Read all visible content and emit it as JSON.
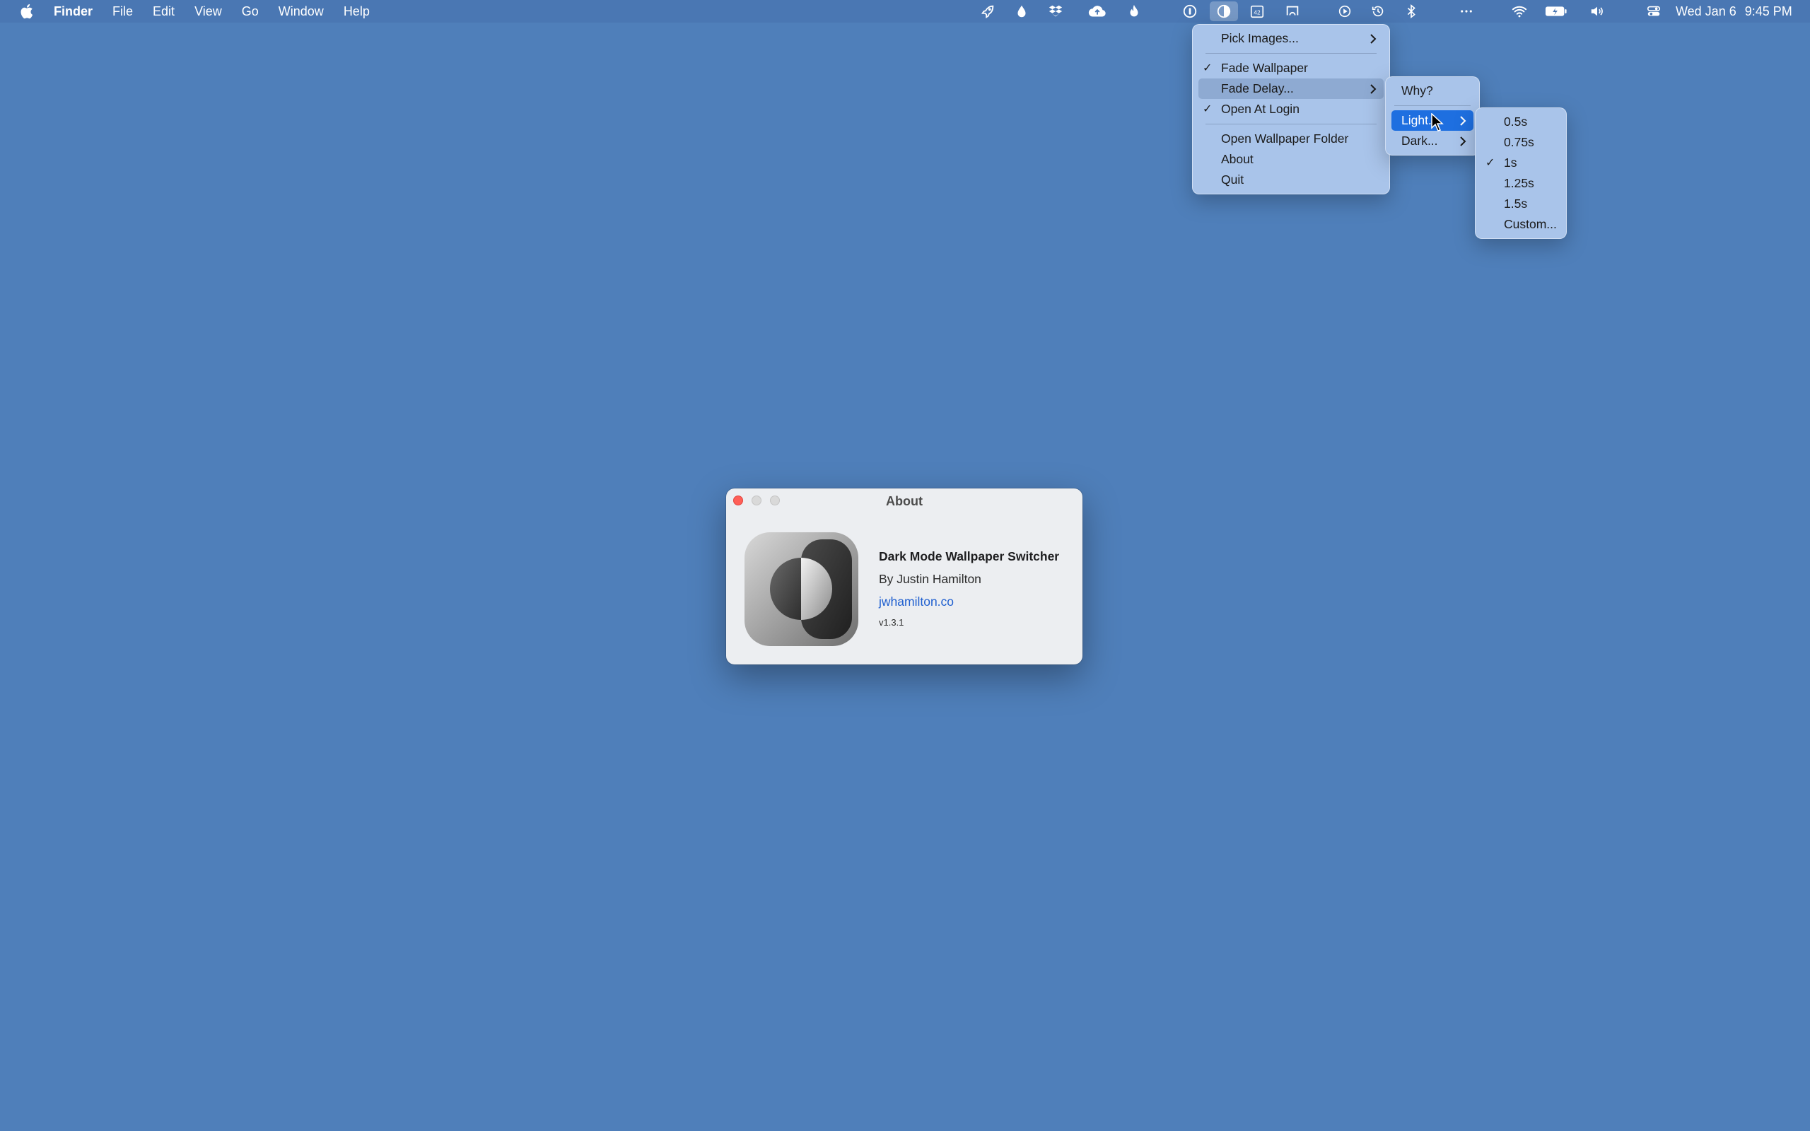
{
  "menubar": {
    "app_name": "Finder",
    "menus": [
      "File",
      "Edit",
      "View",
      "Go",
      "Window",
      "Help"
    ],
    "status_icons": [
      "rocket-icon",
      "drop-icon",
      "dropbox-icon",
      "cloud-upload-icon",
      "flame-icon",
      "onepassword-icon",
      "dark-mode-switcher-icon",
      "calendar-42-icon",
      "screen-mirroring-icon",
      "play-icon",
      "time-machine-icon",
      "bluetooth-icon",
      "more-icon",
      "wifi-icon",
      "battery-icon",
      "volume-icon",
      "control-center-icon"
    ],
    "calendar_badge": "42",
    "date": "Wed Jan 6",
    "time": "9:45 PM"
  },
  "main_menu": {
    "items": [
      {
        "label": "Pick Images...",
        "checked": false,
        "submenu": true
      },
      {
        "label": "Fade Wallpaper",
        "checked": true,
        "submenu": false
      },
      {
        "label": "Fade Delay...",
        "checked": false,
        "submenu": true
      },
      {
        "label": "Open At Login",
        "checked": true,
        "submenu": false
      },
      {
        "label": "Open Wallpaper Folder",
        "checked": false,
        "submenu": false
      },
      {
        "label": "About",
        "checked": false,
        "submenu": false
      },
      {
        "label": "Quit",
        "checked": false,
        "submenu": false
      }
    ]
  },
  "delay_menu": {
    "items": [
      {
        "label": "Why?"
      },
      {
        "label": "Light..."
      },
      {
        "label": "Dark..."
      }
    ]
  },
  "light_menu": {
    "items": [
      {
        "label": "0.5s",
        "checked": false
      },
      {
        "label": "0.75s",
        "checked": false
      },
      {
        "label": "1s",
        "checked": true
      },
      {
        "label": "1.25s",
        "checked": false
      },
      {
        "label": "1.5s",
        "checked": false
      },
      {
        "label": "Custom...",
        "checked": false
      }
    ]
  },
  "about_window": {
    "title": "About",
    "app_name": "Dark Mode Wallpaper Switcher",
    "author": "By Justin Hamilton",
    "link": "jwhamilton.co",
    "version": "v1.3.1"
  },
  "colors": {
    "desktop": "#4f7fba",
    "menu_bg": "#a9c4ea",
    "selected": "#1e6fe0",
    "link": "#1f5fcf"
  }
}
